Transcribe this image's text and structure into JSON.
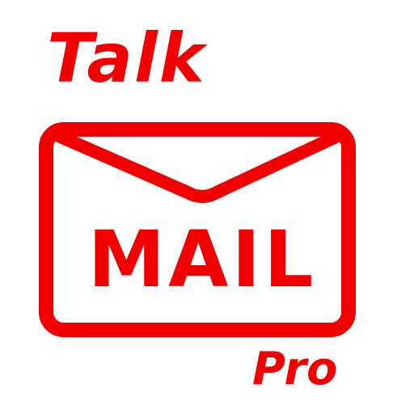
{
  "logo": {
    "word_top": "Talk",
    "word_center": "MAIL",
    "word_badge": "Pro",
    "icon": "envelope-icon",
    "colors": {
      "brand_red": "#f20000",
      "background": "#ffffff"
    }
  }
}
